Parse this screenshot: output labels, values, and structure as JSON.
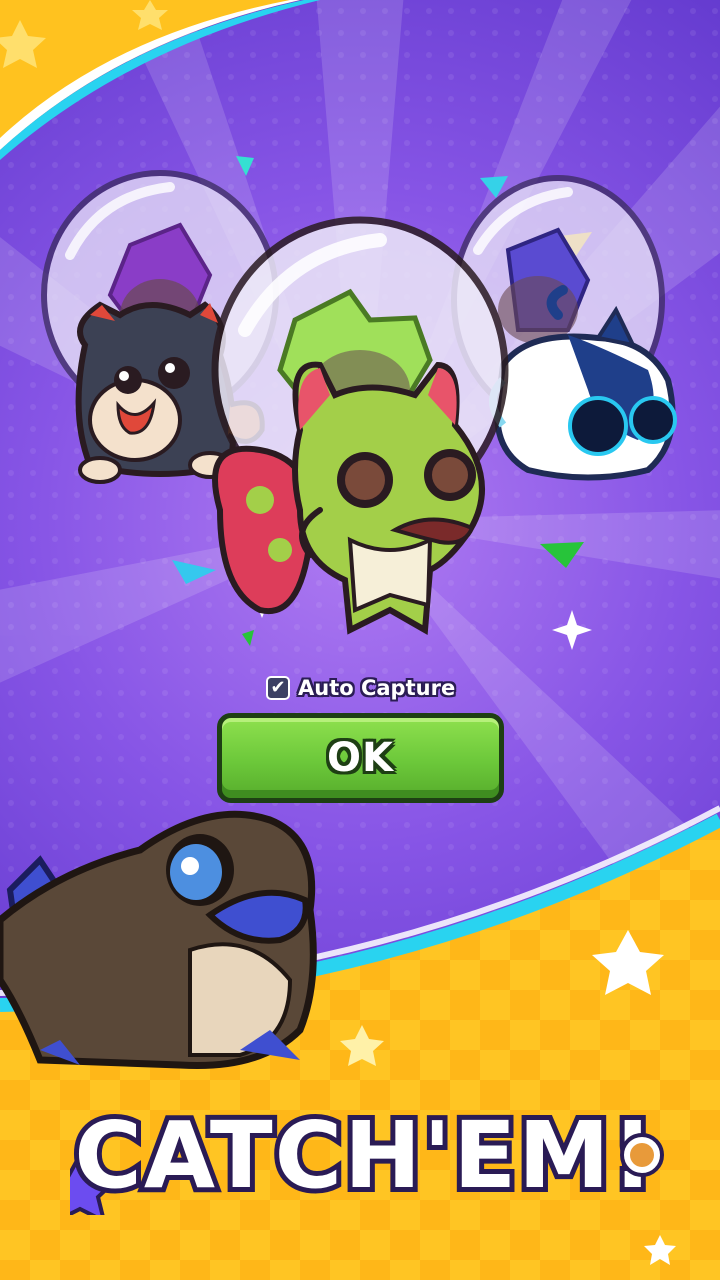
{
  "popup": {
    "auto_capture": {
      "label": "Auto Capture",
      "checked": true
    },
    "ok_button": {
      "label": "OK"
    }
  },
  "banner": {
    "title": "CATCH'EM!"
  },
  "creatures": [
    {
      "name": "black-fox-creature",
      "egg_color": "purple"
    },
    {
      "name": "green-cat-creature",
      "egg_color": "green"
    },
    {
      "name": "blue-robot-cat-creature",
      "egg_color": "blue"
    },
    {
      "name": "brown-platypus-creature"
    }
  ],
  "colors": {
    "background_purple": "#7b4ee0",
    "banner_yellow": "#ffc21f",
    "ok_green": "#6cc83a",
    "ok_border": "#1e3f14"
  }
}
